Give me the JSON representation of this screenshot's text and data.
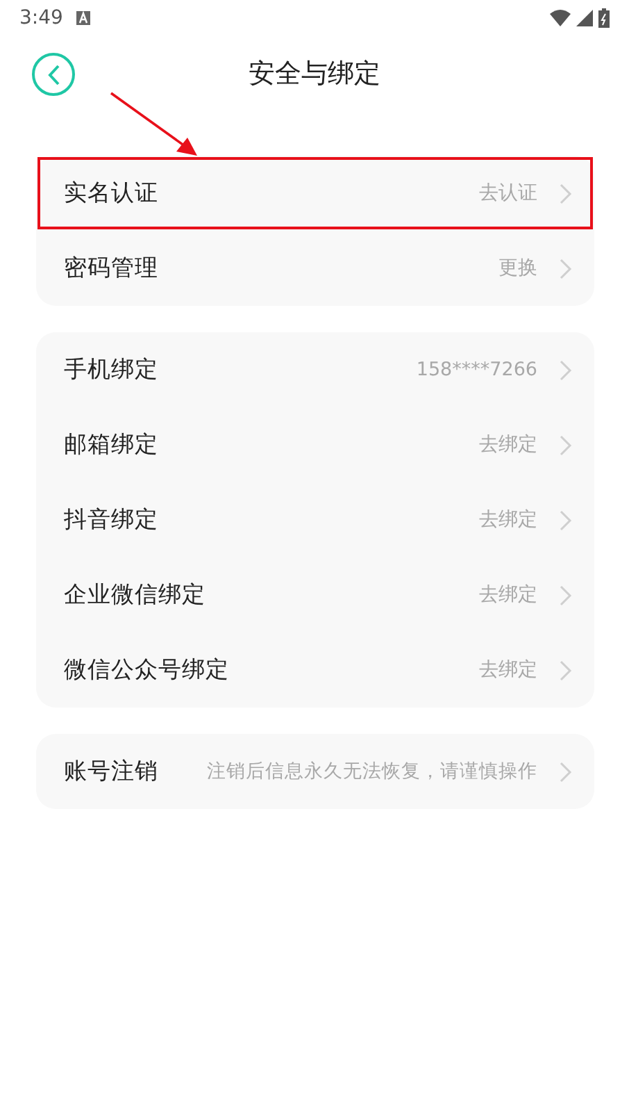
{
  "status_bar": {
    "time": "3:49"
  },
  "header": {
    "title": "安全与绑定"
  },
  "groups": [
    {
      "rows": [
        {
          "label": "实名认证",
          "value": "去认证",
          "highlighted": true
        },
        {
          "label": "密码管理",
          "value": "更换",
          "highlighted": false
        }
      ]
    },
    {
      "rows": [
        {
          "label": "手机绑定",
          "value": "158****7266",
          "highlighted": false
        },
        {
          "label": "邮箱绑定",
          "value": "去绑定",
          "highlighted": false
        },
        {
          "label": "抖音绑定",
          "value": "去绑定",
          "highlighted": false
        },
        {
          "label": "企业微信绑定",
          "value": "去绑定",
          "highlighted": false
        },
        {
          "label": "微信公众号绑定",
          "value": "去绑定",
          "highlighted": false
        }
      ]
    },
    {
      "rows": [
        {
          "label": "账号注销",
          "value": "注销后信息永久无法恢复，请谨慎操作",
          "highlighted": false
        }
      ]
    }
  ]
}
